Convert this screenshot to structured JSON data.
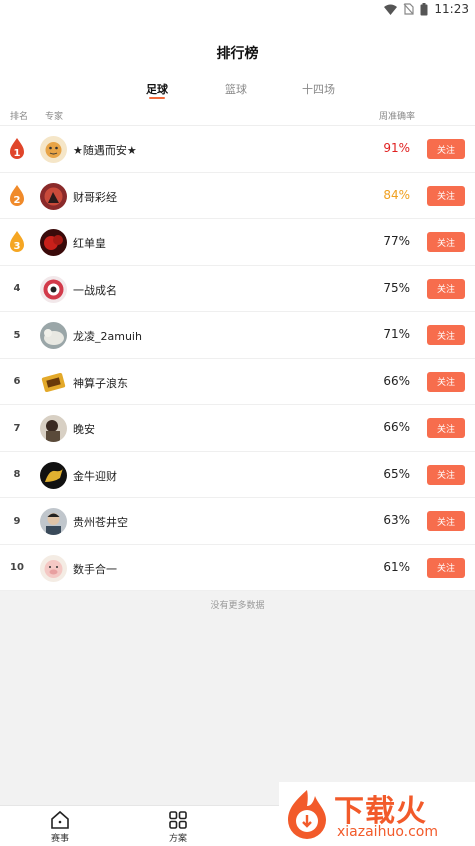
{
  "status_bar": {
    "time": "11:23"
  },
  "page": {
    "title": "排行榜"
  },
  "tabs": [
    {
      "label": "足球",
      "active": true
    },
    {
      "label": "篮球",
      "active": false
    },
    {
      "label": "十四场",
      "active": false
    }
  ],
  "columns": {
    "rank": "排名",
    "expert": "专家",
    "rate": "周准确率"
  },
  "follow_label": "关注",
  "rows": [
    {
      "rank": "1",
      "name": "★随遇而安★",
      "rate": "91%",
      "rate_color": "#e02020"
    },
    {
      "rank": "2",
      "name": "财哥彩经",
      "rate": "84%",
      "rate_color": "#f0a020"
    },
    {
      "rank": "3",
      "name": "红单皇",
      "rate": "77%",
      "rate_color": "#222222"
    },
    {
      "rank": "4",
      "name": "一战成名",
      "rate": "75%",
      "rate_color": "#222222"
    },
    {
      "rank": "5",
      "name": "龙凌_2amuih",
      "rate": "71%",
      "rate_color": "#222222"
    },
    {
      "rank": "6",
      "name": "神算子浪东",
      "rate": "66%",
      "rate_color": "#222222"
    },
    {
      "rank": "7",
      "name": "晚安",
      "rate": "66%",
      "rate_color": "#222222"
    },
    {
      "rank": "8",
      "name": "金牛迎财",
      "rate": "65%",
      "rate_color": "#222222"
    },
    {
      "rank": "9",
      "name": "贵州苍井空",
      "rate": "63%",
      "rate_color": "#222222"
    },
    {
      "rank": "10",
      "name": "数手合一",
      "rate": "61%",
      "rate_color": "#222222"
    }
  ],
  "no_more_text": "没有更多数据",
  "bottom_nav": [
    {
      "label": "赛事",
      "icon": "home-icon"
    },
    {
      "label": "方案",
      "icon": "grid-icon"
    }
  ],
  "watermark": {
    "title": "下载火",
    "url": "xiazaihuo.com"
  },
  "colors": {
    "accent": "#f36a3a",
    "follow_bg": "#f76d4d",
    "top1": "#e02020",
    "top2": "#f0a020"
  }
}
